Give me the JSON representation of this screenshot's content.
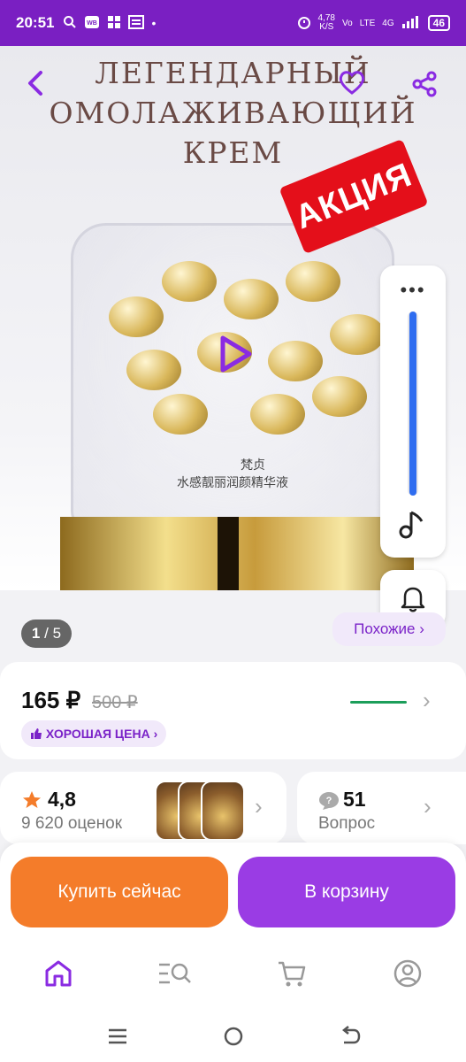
{
  "status_bar": {
    "time": "20:51",
    "network_speed": "4,78\nK/S",
    "network_labels": [
      "Vo",
      "LTE",
      "4G"
    ],
    "battery": "46"
  },
  "hero": {
    "title_lines": [
      "ЛЕГЕНДАРНЫЙ",
      "ОМОЛАЖИВАЮЩИЙ",
      "КРЕМ"
    ],
    "promo_tag": "АКЦИЯ",
    "brand_mark": "梵贞",
    "jar_caption": "水感靓丽润颜精华液"
  },
  "gallery": {
    "counter_current": "1",
    "counter_total": "5",
    "similar_label": "Похожие ›"
  },
  "price": {
    "current": "165 ₽",
    "old": "500 ₽",
    "badge": "ХОРОШАЯ ЦЕНА ›"
  },
  "reviews": {
    "rating": "4,8",
    "count_label": "9 620 оценок"
  },
  "questions": {
    "count": "51",
    "label": "Вопрос"
  },
  "actions": {
    "buy_now": "Купить сейчас",
    "add_to_cart": "В корзину"
  },
  "colors": {
    "brand_purple": "#7a1fc2",
    "buy_orange": "#f47c2a",
    "cart_purple": "#9a3ce4",
    "promo_red": "#e40f1a"
  }
}
